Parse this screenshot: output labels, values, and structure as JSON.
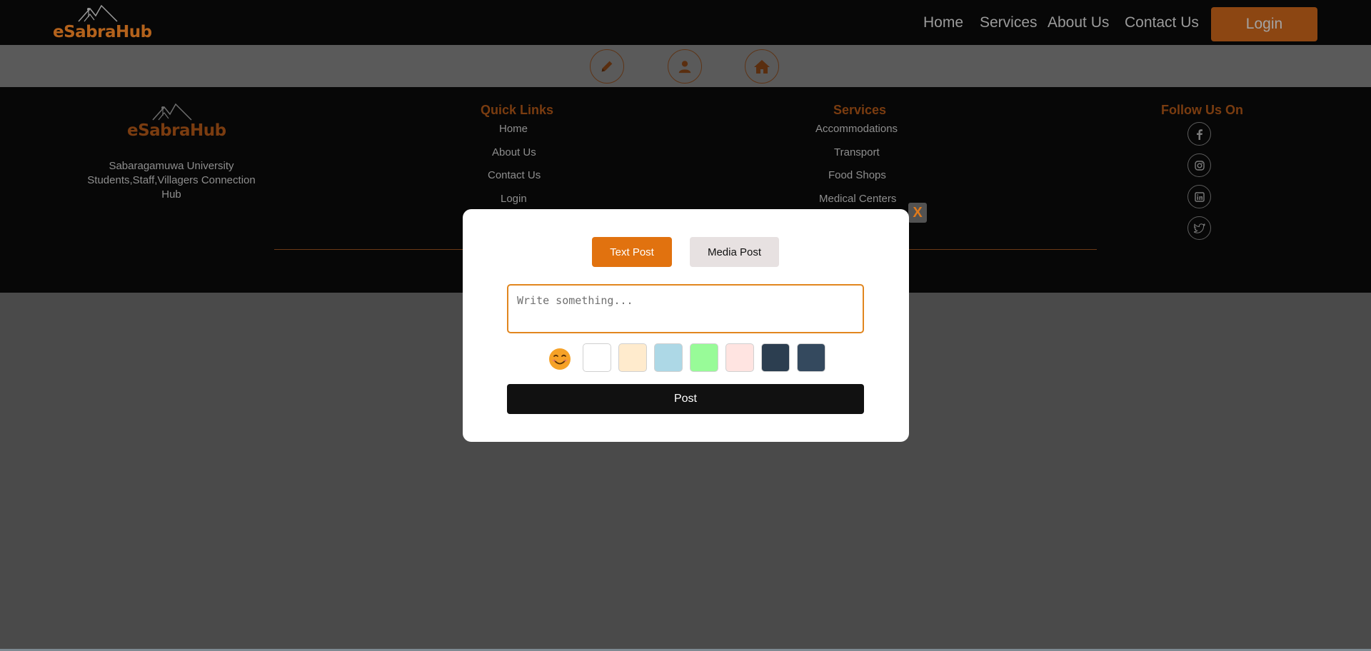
{
  "header": {
    "logo_text": "eSabraHub",
    "nav": [
      "Home",
      "Services",
      "About Us",
      "Contact Us"
    ],
    "login_label": "Login"
  },
  "action_bar": {
    "icons": [
      "pencil-icon",
      "user-icon",
      "home-icon"
    ]
  },
  "footer": {
    "logo_text": "eSabraHub",
    "tagline": "Sabaragamuwa University Students,Staff,Villagers Connection Hub",
    "quick_links": {
      "heading": "Quick Links",
      "items": [
        "Home",
        "About Us",
        "Contact Us",
        "Login"
      ]
    },
    "services": {
      "heading": "Services",
      "items": [
        "Accommodations",
        "Transport",
        "Food Shops",
        "Medical Centers"
      ]
    },
    "follow": {
      "heading": "Follow Us On",
      "icons": [
        "facebook-icon",
        "instagram-icon",
        "linkedin-icon",
        "twitter-icon"
      ]
    }
  },
  "modal": {
    "close_label": "X",
    "tabs": {
      "text_post": "Text Post",
      "media_post": "Media Post"
    },
    "input_placeholder": "Write something...",
    "emoji_icon": "smiling-face-icon",
    "colors": [
      "#ffffff",
      "#ffebcd",
      "#add8e6",
      "#98fb98",
      "#ffe4e1",
      "#2c3e50",
      "#34495e"
    ],
    "post_label": "Post"
  },
  "colors": {
    "accent": "#e1720f",
    "overlay": "#4a4a4a",
    "header_bg": "#070707"
  }
}
